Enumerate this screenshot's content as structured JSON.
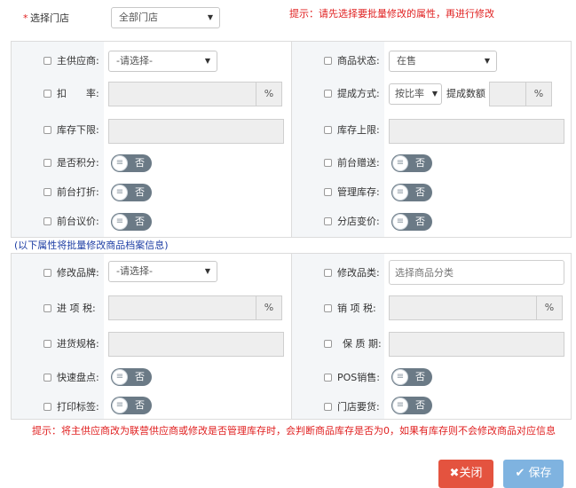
{
  "store": {
    "required_mark": "*",
    "label": "选择门店",
    "value": "全部门店",
    "hint": "提示：请先选择要批量修改的属性，再进行修改"
  },
  "sec1": {
    "supplier": {
      "label": "主供应商:",
      "value": "-请选择-"
    },
    "product_status": {
      "label": "商品状态:",
      "value": "在售"
    },
    "discount": {
      "label": "扣　　率:",
      "unit": "%"
    },
    "commission": {
      "label": "提成方式:",
      "method": "按比率",
      "amount_label": "提成数额",
      "unit": "%"
    },
    "stock_min": {
      "label": "库存下限:"
    },
    "stock_max": {
      "label": "库存上限:"
    },
    "points": {
      "label": "是否积分:",
      "toggle": "否"
    },
    "front_gift": {
      "label": "前台赠送:",
      "toggle": "否"
    },
    "front_discount": {
      "label": "前台打折:",
      "toggle": "否"
    },
    "manage_stock": {
      "label": "管理库存:",
      "toggle": "否"
    },
    "front_bargain": {
      "label": "前台议价:",
      "toggle": "否"
    },
    "branch_price": {
      "label": "分店变价:",
      "toggle": "否"
    }
  },
  "section2_title": "(以下属性将批量修改商品档案信息)",
  "sec2": {
    "brand": {
      "label": "修改品牌:",
      "value": "-请选择-"
    },
    "category": {
      "label": "修改品类:",
      "placeholder": "选择商品分类"
    },
    "input_tax": {
      "label": "进 项 税:",
      "unit": "%"
    },
    "output_tax": {
      "label": "销 项 税:",
      "unit": "%"
    },
    "purchase_spec": {
      "label": "进货规格:"
    },
    "shelf_life": {
      "label": "保 质 期:"
    },
    "quick_count": {
      "label": "快速盘点:",
      "toggle": "否"
    },
    "pos_sale": {
      "label": "POS销售:",
      "toggle": "否"
    },
    "print_label": {
      "label": "打印标签:",
      "toggle": "否"
    },
    "store_request": {
      "label": "门店要货:",
      "toggle": "否"
    }
  },
  "footer_hint": "提示：将主供应商改为联营供应商或修改是否管理库存时，会判断商品库存是否为0，如果有库存则不会修改商品对应信息",
  "buttons": {
    "close": "关闭",
    "save": "保存"
  },
  "colors": {
    "red": "#e02020",
    "blue": "#1f3fa5",
    "close_btn": "#e4533f",
    "save_btn": "#7fb3e0",
    "toggle": "#6b7a86"
  },
  "icons": {
    "close": "x-icon",
    "save": "check-icon",
    "toggle_knob": "menu-lines-icon"
  }
}
